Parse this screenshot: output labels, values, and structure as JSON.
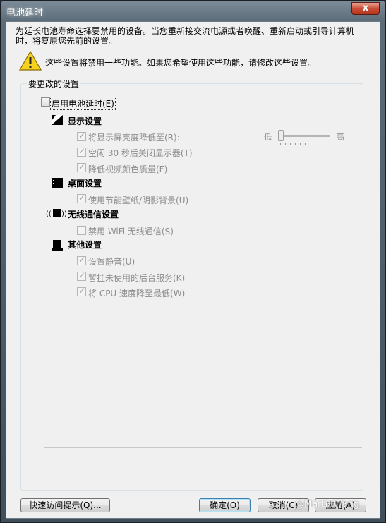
{
  "window": {
    "title": "电池延时",
    "close_label": "x"
  },
  "intro": {
    "text": "为延长电池寿命选择要禁用的设备。当您重新接交流电源或者唤醒、重新启动或引导计算机时，将复原您先前的设置。"
  },
  "warning": {
    "text": "这些设置将禁用一些功能。如果您希望使用这些功能，请修改这些设置。"
  },
  "group": {
    "legend": "要更改的设置",
    "main_checkbox_label": "启用电池延时(E)",
    "main_checked": false
  },
  "sections": {
    "display": {
      "title": "显示设置",
      "items": [
        {
          "label": "将显示屏亮度降低至(R):",
          "checked": true
        },
        {
          "label": "空闲 30 秒后关闭显示器(T)",
          "checked": true
        },
        {
          "label": "降低视频颜色质量(F)",
          "checked": true
        }
      ],
      "slider": {
        "low": "低",
        "high": "高",
        "value": 0
      }
    },
    "desktop": {
      "title": "桌面设置",
      "items": [
        {
          "label": "使用节能壁纸/阴影背景(U)",
          "checked": true
        }
      ]
    },
    "wireless": {
      "title": "无线通信设置",
      "items": [
        {
          "label": "禁用 WiFi 无线通信(S)",
          "checked": false
        }
      ]
    },
    "other": {
      "title": "其他设置",
      "items": [
        {
          "label": "设置静音(U)",
          "checked": true
        },
        {
          "label": "暂挂未使用的后台服务(K)",
          "checked": true
        },
        {
          "label": "将 CPU 速度降至最低(W)",
          "checked": true
        }
      ]
    }
  },
  "buttons": {
    "quick_tips": "快速访问提示(Q)...",
    "ok": "确定(O)",
    "cancel": "取消(C)",
    "apply": "应用(A)"
  },
  "watermark": "@MartinWang"
}
